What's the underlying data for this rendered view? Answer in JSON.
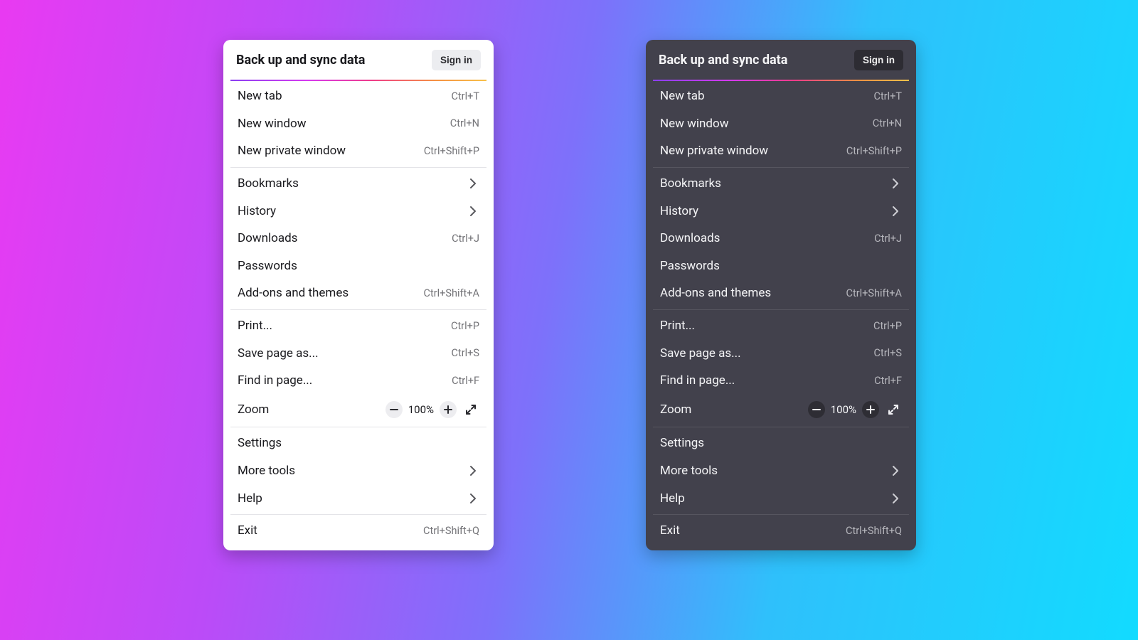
{
  "menu": {
    "title": "Back up and sync data",
    "signin": "Sign in",
    "zoom_value": "100%",
    "items": {
      "newtab": {
        "label": "New tab",
        "key": "Ctrl+T"
      },
      "newwin": {
        "label": "New window",
        "key": "Ctrl+N"
      },
      "newpriv": {
        "label": "New private window",
        "key": "Ctrl+Shift+P"
      },
      "bookmarks": {
        "label": "Bookmarks"
      },
      "history": {
        "label": "History"
      },
      "downloads": {
        "label": "Downloads",
        "key": "Ctrl+J"
      },
      "passwords": {
        "label": "Passwords"
      },
      "addons": {
        "label": "Add-ons and themes",
        "key": "Ctrl+Shift+A"
      },
      "print": {
        "label": "Print...",
        "key": "Ctrl+P"
      },
      "save": {
        "label": "Save page as...",
        "key": "Ctrl+S"
      },
      "find": {
        "label": "Find in page...",
        "key": "Ctrl+F"
      },
      "zoom": {
        "label": "Zoom"
      },
      "settings": {
        "label": "Settings"
      },
      "moretools": {
        "label": "More tools"
      },
      "help": {
        "label": "Help"
      },
      "exit": {
        "label": "Exit",
        "key": "Ctrl+Shift+Q"
      }
    }
  }
}
